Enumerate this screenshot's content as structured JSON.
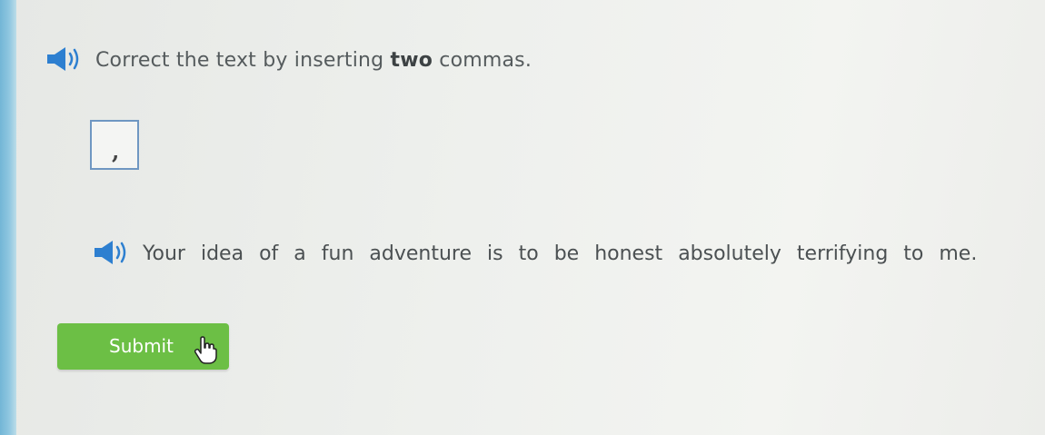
{
  "instruction": {
    "prefix": "Correct the text by inserting ",
    "emphasis": "two",
    "suffix": " commas."
  },
  "comma_tile": {
    "symbol": ","
  },
  "sentence": {
    "words": [
      "Your",
      "idea",
      "of",
      "a",
      "fun",
      "adventure",
      "is",
      "to",
      "be",
      "honest",
      "absolutely",
      "terrifying",
      "to",
      "me."
    ]
  },
  "submit": {
    "label": "Submit"
  },
  "icons": {
    "instruction_audio": "speaker-icon",
    "sentence_audio": "speaker-icon",
    "cursor": "pointer-hand-icon"
  },
  "colors": {
    "accent_blue": "#2d7fd0",
    "submit_green": "#6cbf45",
    "tile_border": "#6f97c2"
  }
}
